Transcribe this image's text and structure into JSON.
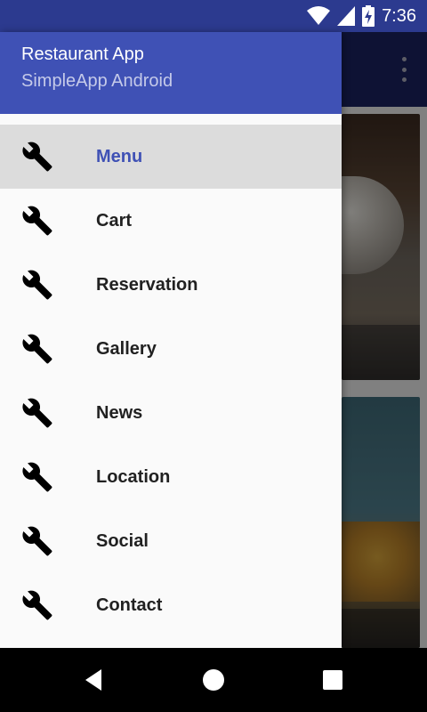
{
  "status_bar": {
    "time": "7:36",
    "icons": [
      "wifi-icon",
      "cell-signal-icon",
      "battery-charging-icon"
    ],
    "background": "#2c3a8f"
  },
  "toolbar": {
    "overflow_icon": "more-vert-icon"
  },
  "drawer": {
    "header": {
      "title": "Restaurant App",
      "subtitle": "SimpleApp Android",
      "background": "#3f51b5"
    },
    "active_index": 0,
    "items": [
      {
        "label": "Menu",
        "icon": "wrench-icon"
      },
      {
        "label": "Cart",
        "icon": "wrench-icon"
      },
      {
        "label": "Reservation",
        "icon": "wrench-icon"
      },
      {
        "label": "Gallery",
        "icon": "wrench-icon"
      },
      {
        "label": "News",
        "icon": "wrench-icon"
      },
      {
        "label": "Location",
        "icon": "wrench-icon"
      },
      {
        "label": "Social",
        "icon": "wrench-icon"
      },
      {
        "label": "Contact",
        "icon": "wrench-icon"
      }
    ]
  },
  "nav_bar": {
    "buttons": [
      "back-icon",
      "home-icon",
      "recents-icon"
    ]
  },
  "colors": {
    "accent": "#3f51b5",
    "active_item_bg": "#dcdcdc"
  }
}
